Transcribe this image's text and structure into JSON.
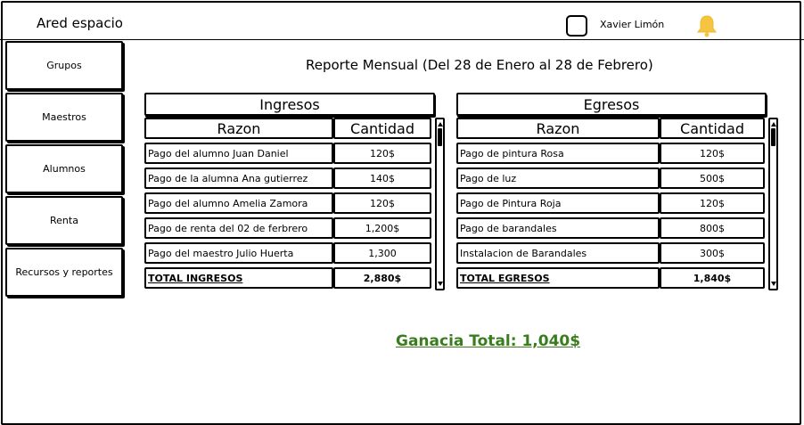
{
  "app": {
    "title": "Ared espacio",
    "user_name": "Xavier Limón"
  },
  "sidebar": {
    "items": [
      {
        "label": "Grupos"
      },
      {
        "label": "Maestros"
      },
      {
        "label": "Alumnos"
      },
      {
        "label": "Renta"
      },
      {
        "label": "Recursos y reportes"
      }
    ]
  },
  "report": {
    "title": "Reporte Mensual (Del 28 de Enero al 28 de Febrero)"
  },
  "ingresos": {
    "title": "Ingresos",
    "col_reason": "Razon",
    "col_amount": "Cantidad",
    "rows": [
      {
        "reason": "Pago del alumno Juan Daniel",
        "amount": "120$"
      },
      {
        "reason": "Pago de la alumna Ana gutierrez",
        "amount": "140$"
      },
      {
        "reason": "Pago del alumno Amelia Zamora",
        "amount": "120$"
      },
      {
        "reason": "Pago de renta del 02 de ferbrero",
        "amount": "1,200$"
      },
      {
        "reason": "Pago del maestro Julio Huerta",
        "amount": "1,300"
      }
    ],
    "total_label": "TOTAL INGRESOS",
    "total_amount": "2,880$"
  },
  "egresos": {
    "title": "Egresos",
    "col_reason": "Razon",
    "col_amount": "Cantidad",
    "rows": [
      {
        "reason": "Pago de pintura Rosa",
        "amount": "120$"
      },
      {
        "reason": "Pago de luz",
        "amount": "500$"
      },
      {
        "reason": "Pago de Pintura Roja",
        "amount": "120$"
      },
      {
        "reason": "Pago de barandales",
        "amount": "800$"
      },
      {
        "reason": "Instalacion de Barandales",
        "amount": "300$"
      }
    ],
    "total_label": "TOTAL EGRESOS",
    "total_amount": "1,840$"
  },
  "summary": {
    "ganancia_label": "Ganacia Total: 1,040$"
  },
  "colors": {
    "ganancia_text": "#3a7d1e",
    "bell_fill": "#f5c542"
  },
  "icons": {
    "avatar": "checkbox-square",
    "notifications": "bell-icon"
  }
}
